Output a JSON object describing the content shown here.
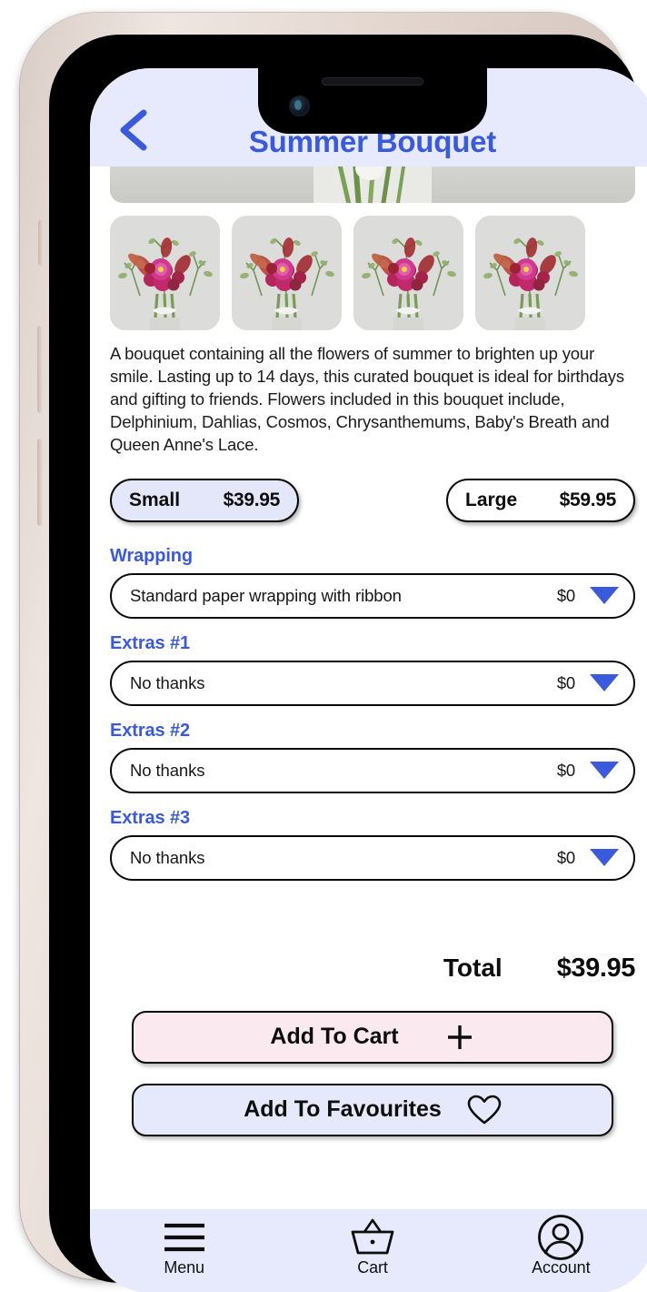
{
  "header": {
    "title": "Summer Bouquet",
    "back_icon": "chevron-left-icon",
    "accent_color": "#3a5ad9",
    "background_color": "#e6eafc"
  },
  "gallery": {
    "thumbnail_count": 4,
    "thumbnail_alt": "summer bouquet photo"
  },
  "description": {
    "paragraph": "A bouquet containing all the flowers of summer to brighten up your smile. Lasting up to 14 days, this curated bouquet is ideal for birthdays and gifting to friends.\nFlowers included in this bouquet include, Delphinium, Dahlias, Cosmos, Chrysanthemums, Baby's Breath and Queen Anne's Lace."
  },
  "sizes": [
    {
      "label": "Small",
      "price": "$39.95",
      "selected": true
    },
    {
      "label": "Large",
      "price": "$59.95",
      "selected": false
    }
  ],
  "options": [
    {
      "label": "Wrapping",
      "value": "Standard paper wrapping with ribbon",
      "price": "$0",
      "icon": "chevron-down-icon"
    },
    {
      "label": "Extras #1",
      "value": "No thanks",
      "price": "$0",
      "icon": "chevron-down-icon"
    },
    {
      "label": "Extras #2",
      "value": "No thanks",
      "price": "$0",
      "icon": "chevron-down-icon"
    },
    {
      "label": "Extras #3",
      "value": "No thanks",
      "price": "$0",
      "icon": "chevron-down-icon"
    }
  ],
  "total": {
    "label": "Total",
    "value": "$39.95"
  },
  "actions": {
    "cart": {
      "label": "Add To Cart",
      "icon": "plus-icon",
      "background_color": "#fae9ee"
    },
    "favourites": {
      "label": "Add To Favourites",
      "icon": "heart-icon",
      "background_color": "#e6e9fb"
    }
  },
  "bottom_nav": [
    {
      "label": "Menu",
      "icon": "hamburger-menu-icon"
    },
    {
      "label": "Cart",
      "icon": "shopping-basket-icon"
    },
    {
      "label": "Account",
      "icon": "user-circle-icon"
    }
  ]
}
